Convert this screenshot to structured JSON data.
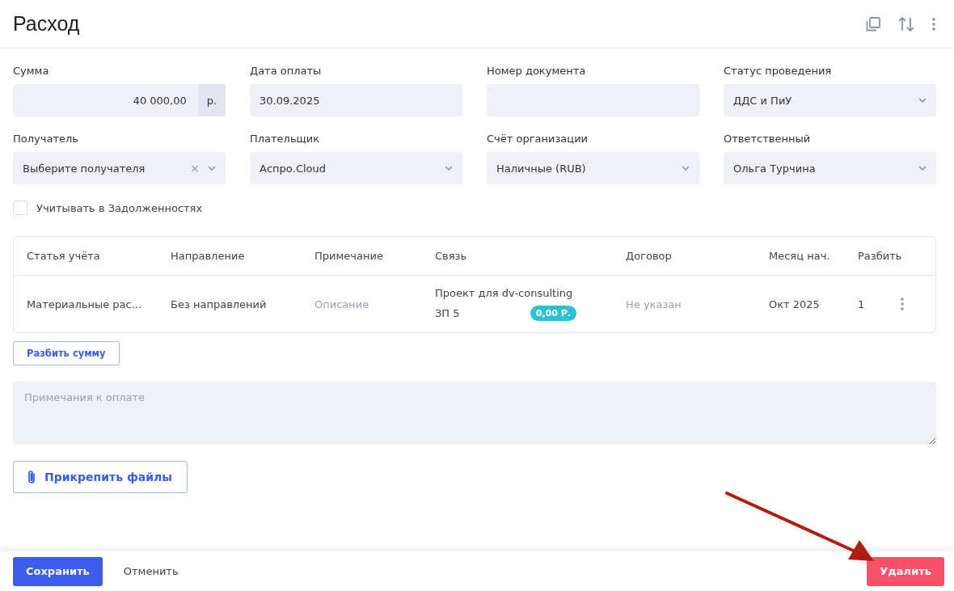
{
  "title": "Расход",
  "fields": [
    {
      "label": "Сумма",
      "kind": "amount",
      "value": "40 000,00",
      "suffix": "р."
    },
    {
      "label": "Дата оплаты",
      "kind": "text",
      "value": "30.09.2025"
    },
    {
      "label": "Номер документа",
      "kind": "text"
    },
    {
      "label": "Статус проведения",
      "kind": "select",
      "value": "ДДС и ПиУ"
    },
    {
      "label": "Получатель",
      "kind": "select",
      "placeholder": "Выберите получателя",
      "clear": "×"
    },
    {
      "label": "Плательщик",
      "kind": "select",
      "value": "Аспро.Cloud"
    },
    {
      "label": "Счёт организации",
      "kind": "select",
      "value": "Наличные (RUB)"
    },
    {
      "label": "Ответственный",
      "kind": "select",
      "value": "Ольга Турчина"
    }
  ],
  "debt_checkbox": {
    "label": "Учитывать в Задолженностях",
    "checked": false
  },
  "table": {
    "columns": [
      "Статья учёта",
      "Направление",
      "Примечание",
      "Связь",
      "Договор",
      "Месяц нач.",
      "Разбить"
    ],
    "rows": [
      {
        "article": "Материальные рас...",
        "direction": "Без направлений",
        "note": "Описание",
        "link": "Проект для dv-consulting",
        "link_sub": "ЗП 5",
        "link_amount": "0,00 Р.",
        "contract": "Не указан",
        "month": "Окт 2025",
        "split": "1"
      }
    ]
  },
  "split_button": "Разбить сумму",
  "notes": {
    "placeholder": "Примечания к оплате"
  },
  "attach_button": "Прикрепить файлы",
  "footer": {
    "save": "Сохранить",
    "cancel": "Отменить",
    "delete": "Удалить"
  }
}
